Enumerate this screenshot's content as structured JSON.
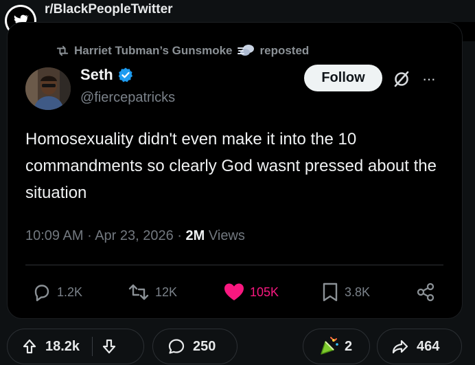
{
  "subreddit": {
    "name": "r/BlackPeopleTwitter"
  },
  "repost": {
    "author": "Harriet Tubman’s Gunsmoke",
    "label": "reposted"
  },
  "author": {
    "name": "Seth",
    "handle": "@fiercepatricks",
    "verified": true
  },
  "actions_top": {
    "follow_label": "Follow",
    "more_label": "···"
  },
  "tweet": {
    "text": "Homosexuality didn't even make it into the 10 commandments so clearly God wasnt pressed about the situation"
  },
  "meta": {
    "time": "10:09 AM",
    "sep1": "·",
    "date": "Apr 23, 2026",
    "sep2": "·",
    "views_count": "2M",
    "views_label": "Views"
  },
  "stats": {
    "replies": "1.2K",
    "reposts": "12K",
    "likes": "105K",
    "bookmarks": "3.8K"
  },
  "reddit": {
    "upvotes": "18.2k",
    "comments": "250",
    "awards": "2",
    "shares": "464"
  },
  "colors": {
    "like": "#f91880",
    "verified": "#1d9bf0",
    "award": "#7ecb2d"
  }
}
